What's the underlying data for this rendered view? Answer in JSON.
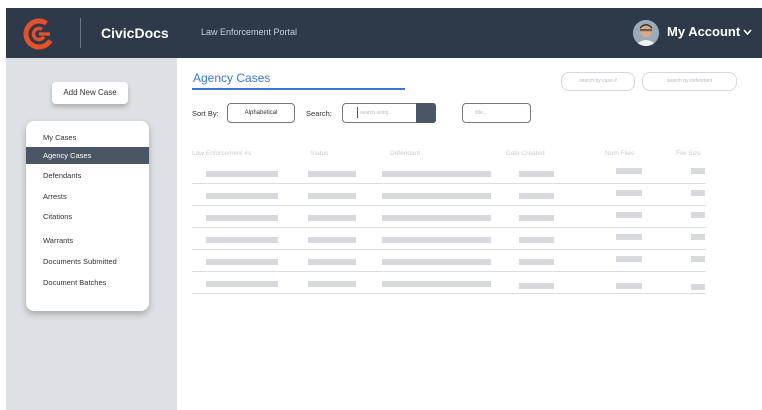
{
  "app": {
    "brand": "CivicDocs",
    "portal": "Law Enforcement Portal",
    "brand_color": "#e8502a"
  },
  "account": {
    "label": "My Account"
  },
  "sidebar": {
    "add_button": "Add New Case",
    "items": [
      {
        "label": "My Cases",
        "active": false
      },
      {
        "label": "Agency Cases",
        "active": true
      },
      {
        "label": "Defendants",
        "active": false
      },
      {
        "label": "Arrests",
        "active": false
      },
      {
        "label": "Citations",
        "active": false
      },
      {
        "label": "Warrants",
        "active": false
      },
      {
        "label": "Documents Submitted",
        "active": false
      },
      {
        "label": "Document Batches",
        "active": false
      }
    ]
  },
  "main": {
    "title": "Agency Cases",
    "search_by_case_placeholder": "search by case #",
    "search_by_defendant_placeholder": "search by defendant",
    "sort_label": "Sort By:",
    "sort_value": "Alphabetical",
    "search_label": "Search:",
    "search_placeholder": "search using...",
    "filter_placeholder": "title...",
    "columns": [
      "Law Enforcement #s",
      "Status",
      "Defendant",
      "Date Created",
      "Num Files",
      "File Size"
    ],
    "row_count": 6
  },
  "colors": {
    "header_bg": "#2e3a4a",
    "accent": "#3a78d8",
    "active_nav": "#4a5666",
    "sidebar_bg": "#dde0e4"
  }
}
